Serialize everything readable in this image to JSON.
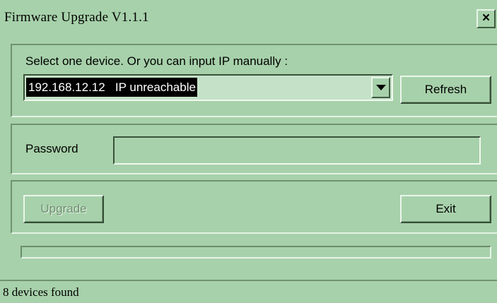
{
  "window": {
    "title": "Firmware Upgrade  V1.1.1",
    "close_label": "×"
  },
  "device_group": {
    "prompt": "Select one device. Or you can input IP manually :",
    "selected_device": "192.168.12.12   IP unreachable",
    "refresh_label": "Refresh"
  },
  "password_group": {
    "label": "Password",
    "value": ""
  },
  "actions": {
    "upgrade_label": "Upgrade",
    "upgrade_enabled": false,
    "exit_label": "Exit"
  },
  "progress": {
    "fraction": 0
  },
  "status_bar": {
    "text": "8 devices found"
  },
  "icons": {
    "combo_arrow": "chevron-down-icon"
  },
  "colors": {
    "window_bg": "#a7d1aa",
    "selection_bg": "#000000",
    "selection_text": "#ffffff",
    "disabled_text": "#6f8d71"
  }
}
